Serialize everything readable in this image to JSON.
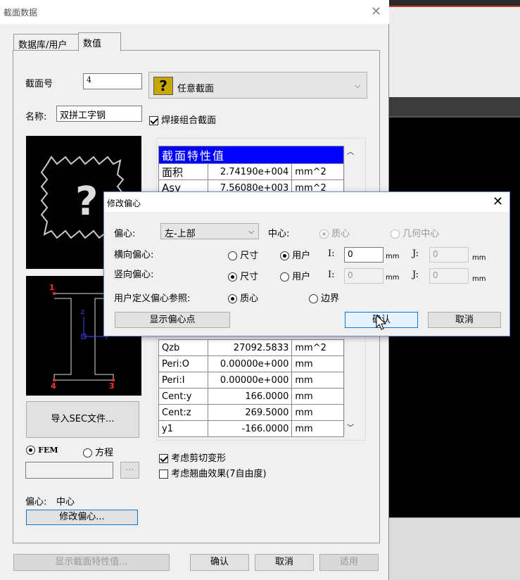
{
  "window": {
    "title": "截面数据"
  },
  "tabs": [
    "数据库/用户",
    "数值"
  ],
  "section": {
    "number_label": "截面号",
    "number_value": "4",
    "type_value": "任意截面",
    "name_label": "名称:",
    "name_value": "双拼工字钢",
    "welded_label": "焊接组合截面"
  },
  "props_table": {
    "header": "截面特性值",
    "rows_top": [
      {
        "name": "面积",
        "value": "2.74190e+004",
        "unit": "mm^2"
      },
      {
        "name": "Asy",
        "value": "7.56080e+003",
        "unit": "mm^2"
      }
    ],
    "rows_bottom": [
      {
        "name": "Qzb",
        "value": "27092.5833",
        "unit": "mm^2"
      },
      {
        "name": "Peri:O",
        "value": "0.00000e+000",
        "unit": "mm"
      },
      {
        "name": "Peri:I",
        "value": "0.00000e+000",
        "unit": "mm"
      },
      {
        "name": "Cent:y",
        "value": "166.0000",
        "unit": "mm"
      },
      {
        "name": "Cent:z",
        "value": "269.5000",
        "unit": "mm"
      },
      {
        "name": "y1",
        "value": "-166.0000",
        "unit": "mm"
      }
    ]
  },
  "drawing": {
    "p1": "1",
    "p3": "3",
    "p4": "4",
    "axis_z": "z",
    "axis_y": "y"
  },
  "left_controls": {
    "import_label": "导入SEC文件...",
    "fem_label": "FEM",
    "equation_label": "方程",
    "browse_label": "...",
    "offset_label": "偏心:",
    "offset_value": "中心",
    "modify_offset_label": "修改偏心..."
  },
  "options": {
    "shear_label": "考虑剪切变形",
    "warp_label": "考虑翘曲效果(7自由度)"
  },
  "bottom": {
    "show_props": "显示截面特性值...",
    "ok": "确认",
    "cancel": "取消",
    "apply": "适用"
  },
  "modal": {
    "title": "修改偏心",
    "offset_label": "偏心:",
    "offset_value": "左-上部",
    "center_label": "中心:",
    "centroid_label": "质心",
    "geo_center_label": "几何中心",
    "horizontal_label": "横向偏心:",
    "vertical_label": "竖向偏心:",
    "dimension_label": "尺寸",
    "user_label": "用户",
    "i_label": "I:",
    "j_label": "J:",
    "h_i_value": "0",
    "h_j_value": "0",
    "v_i_value": "0",
    "v_j_value": "0",
    "unit_mm": "mm",
    "user_ref_label": "用户定义偏心参照:",
    "ref_centroid_label": "质心",
    "ref_boundary_label": "边界",
    "show_point_label": "显示偏心点",
    "ok_label": "确认",
    "cancel_label": "取消"
  }
}
